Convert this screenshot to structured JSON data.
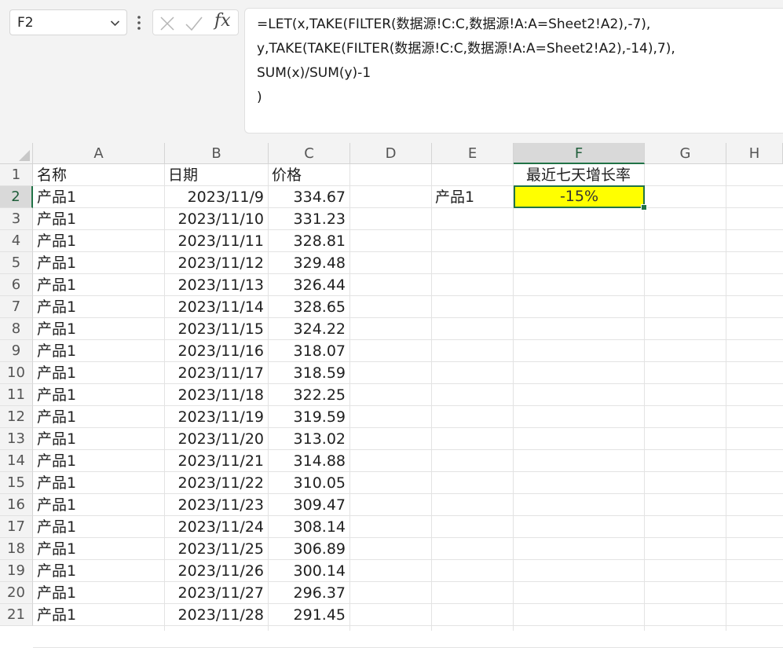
{
  "formula_bar": {
    "name_box": "F2",
    "fx_label": "fx",
    "lines": [
      "=LET(x,TAKE(FILTER(数据源!C:C,数据源!A:A=Sheet2!A2),-7),",
      "y,TAKE(TAKE(FILTER(数据源!C:C,数据源!A:A=Sheet2!A2),-14),7),",
      "SUM(x)/SUM(y)-1",
      ")"
    ]
  },
  "sheet": {
    "columns": [
      "A",
      "B",
      "C",
      "D",
      "E",
      "F",
      "G",
      "H"
    ],
    "row_numbers": [
      "1",
      "2",
      "3",
      "4",
      "5",
      "6",
      "7",
      "8",
      "9",
      "10",
      "11",
      "12",
      "13",
      "14",
      "15",
      "16",
      "17",
      "18",
      "19",
      "20",
      "21"
    ],
    "headers": {
      "name": "名称",
      "date": "日期",
      "price": "价格"
    },
    "rows": [
      {
        "name": "产品1",
        "date": "2023/11/9",
        "price": "334.67"
      },
      {
        "name": "产品1",
        "date": "2023/11/10",
        "price": "331.23"
      },
      {
        "name": "产品1",
        "date": "2023/11/11",
        "price": "328.81"
      },
      {
        "name": "产品1",
        "date": "2023/11/12",
        "price": "329.48"
      },
      {
        "name": "产品1",
        "date": "2023/11/13",
        "price": "326.44"
      },
      {
        "name": "产品1",
        "date": "2023/11/14",
        "price": "328.65"
      },
      {
        "name": "产品1",
        "date": "2023/11/15",
        "price": "324.22"
      },
      {
        "name": "产品1",
        "date": "2023/11/16",
        "price": "318.07"
      },
      {
        "name": "产品1",
        "date": "2023/11/17",
        "price": "318.59"
      },
      {
        "name": "产品1",
        "date": "2023/11/18",
        "price": "322.25"
      },
      {
        "name": "产品1",
        "date": "2023/11/19",
        "price": "319.59"
      },
      {
        "name": "产品1",
        "date": "2023/11/20",
        "price": "313.02"
      },
      {
        "name": "产品1",
        "date": "2023/11/21",
        "price": "314.88"
      },
      {
        "name": "产品1",
        "date": "2023/11/22",
        "price": "310.05"
      },
      {
        "name": "产品1",
        "date": "2023/11/23",
        "price": "309.47"
      },
      {
        "name": "产品1",
        "date": "2023/11/24",
        "price": "308.14"
      },
      {
        "name": "产品1",
        "date": "2023/11/25",
        "price": "306.89"
      },
      {
        "name": "产品1",
        "date": "2023/11/26",
        "price": "300.14"
      },
      {
        "name": "产品1",
        "date": "2023/11/27",
        "price": "296.37"
      },
      {
        "name": "产品1",
        "date": "2023/11/28",
        "price": "291.45"
      }
    ],
    "summary": {
      "f1_header": "最近七天增长率",
      "e2_product": "产品1",
      "f2_value": "-15%"
    },
    "selected_cell": "F2",
    "colors": {
      "highlight": "#ffff00",
      "selection": "#217346"
    }
  }
}
